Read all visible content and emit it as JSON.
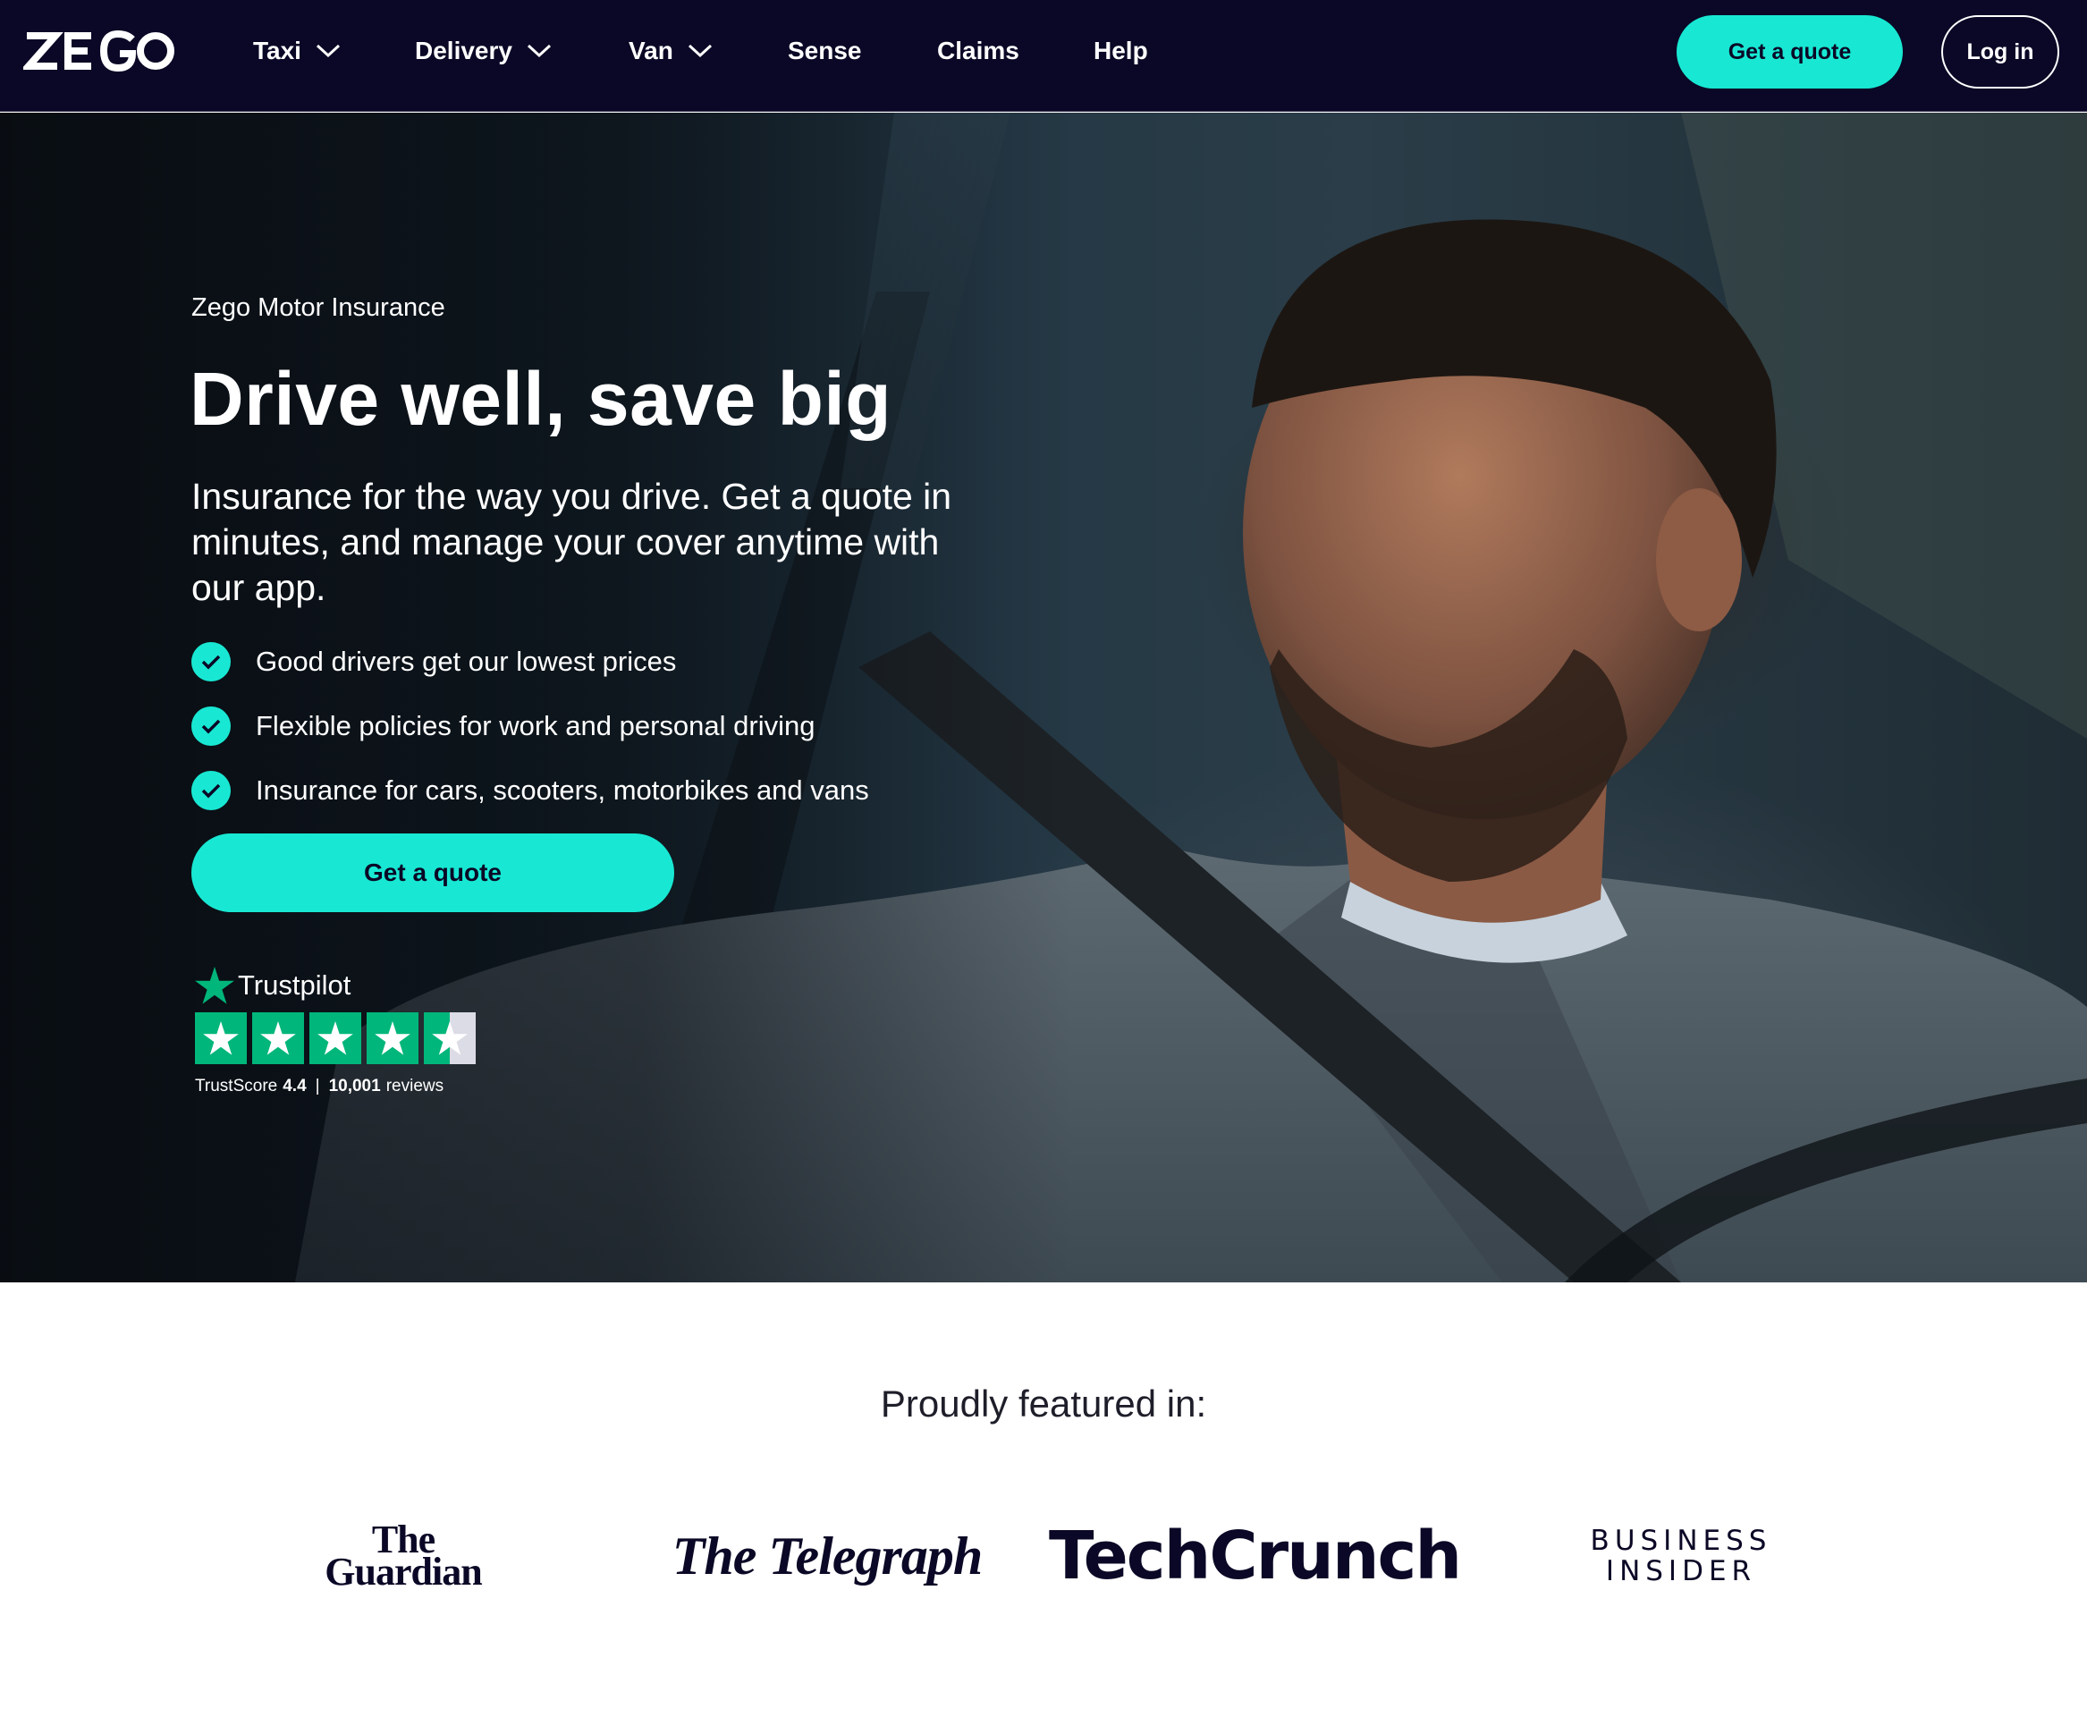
{
  "nav": {
    "logo_text": "ZEGO",
    "items": [
      {
        "label": "Taxi",
        "has_dropdown": true
      },
      {
        "label": "Delivery",
        "has_dropdown": true
      },
      {
        "label": "Van",
        "has_dropdown": true
      },
      {
        "label": "Sense",
        "has_dropdown": false
      },
      {
        "label": "Claims",
        "has_dropdown": false
      },
      {
        "label": "Help",
        "has_dropdown": false
      }
    ],
    "quote_label": "Get a quote",
    "login_label": "Log in"
  },
  "hero": {
    "eyebrow": "Zego Motor Insurance",
    "headline": "Drive well, save big",
    "subheadline": "Insurance for the way you drive. Get a quote in minutes, and manage your cover anytime with our app.",
    "benefits": [
      "Good drivers get our lowest prices",
      "Flexible policies for work and personal driving",
      "Insurance for cars, scooters, motorbikes and vans"
    ],
    "cta_label": "Get a quote"
  },
  "trustpilot": {
    "brand": "Trustpilot",
    "stars": 4.5,
    "score_label": "TrustScore",
    "score": "4.4",
    "separator": "|",
    "reviews": "10,001",
    "reviews_label": "reviews"
  },
  "featured": {
    "title": "Proudly featured in:",
    "logos": {
      "guardian_line1": "The",
      "guardian_line2": "Guardian",
      "telegraph": "The Telegraph",
      "techcrunch": "TechCrunch",
      "bi_line1": "BUSINESS",
      "bi_line2": "INSIDER"
    }
  },
  "colors": {
    "nav_bg": "#0a0826",
    "accent": "#18e8d3",
    "trustpilot_green": "#00b67a",
    "press_text": "#0a0826"
  },
  "icons": [
    "zego-logo",
    "chevron-down-icon",
    "check-icon",
    "trustpilot-star-icon"
  ]
}
